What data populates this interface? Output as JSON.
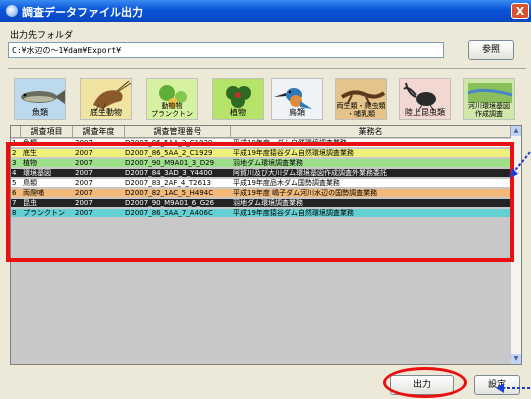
{
  "window": {
    "title": "調査データファイル出力",
    "close_glyph": "X"
  },
  "output_folder": {
    "label": "出力先フォルダ",
    "value": "C:¥水辺の〜1¥dam¥Export¥",
    "browse_label": "参照"
  },
  "categories": [
    {
      "label": "魚類",
      "icon": "fish-icon"
    },
    {
      "label": "底生動物",
      "icon": "shrimp-icon"
    },
    {
      "label": "動植物\nプランクトン",
      "icon": "plankton-icon"
    },
    {
      "label": "植物",
      "icon": "plant-icon"
    },
    {
      "label": "鳥類",
      "icon": "kingfisher-icon"
    },
    {
      "label": "両生類・爬虫類\n・哺乳類",
      "icon": "salamander-icon"
    },
    {
      "label": "陸上昆虫類",
      "icon": "beetle-icon"
    },
    {
      "label": "河川環境基図\n作成調査",
      "icon": "map-photo-icon"
    }
  ],
  "table": {
    "columns": [
      "",
      "調査項目",
      "調査年度",
      "調査管理番号",
      "業務名"
    ],
    "rows": [
      {
        "num": "1",
        "item": "魚類",
        "year": "2007",
        "code": "D2007_86_5AA_2_C1929",
        "name": "平成19年度…ダム自然環境調査業務",
        "bg": "#ffffff",
        "fg": "#000000"
      },
      {
        "num": "2",
        "item": "底生",
        "year": "2007",
        "code": "D2007_86_5AA_2_C1929",
        "name": "平成19年度猿谷ダム自然環境調査業務",
        "bg": "#f0f07a",
        "fg": "#000000"
      },
      {
        "num": "3",
        "item": "植物",
        "year": "2007",
        "code": "D2007_90_M9A01_3_D29",
        "name": "羽地ダム環境調査業務",
        "bg": "#9ce08a",
        "fg": "#000000"
      },
      {
        "num": "4",
        "item": "環境基図",
        "year": "2007",
        "code": "D2007_84_3AD_3_Y4400",
        "name": "阿賀川及び大川ダム環境基図作成調査外業務委託",
        "bg": "#232323",
        "fg": "#ffffff"
      },
      {
        "num": "5",
        "item": "鳥類",
        "year": "2007",
        "code": "D2007_83_2AF_4_T2613",
        "name": "平成19年度品木ダム国勢調査業務",
        "bg": "#ffffff",
        "fg": "#000000"
      },
      {
        "num": "6",
        "item": "両爬哺",
        "year": "2007",
        "code": "D2007_82_1AC_5_H494C",
        "name": "平成19年度 嶋子ダム河川水辺の国勢調査業務",
        "bg": "#f2b978",
        "fg": "#000000"
      },
      {
        "num": "7",
        "item": "昆虫",
        "year": "2007",
        "code": "D2007_90_M9A01_6_G26",
        "name": "羽地ダム環境調査業務",
        "bg": "#232323",
        "fg": "#ffffff"
      },
      {
        "num": "8",
        "item": "プランクトン",
        "year": "2007",
        "code": "D2007_86_5AA_7_A406C",
        "name": "平成19年度猿谷ダム自然環境調査業務",
        "bg": "#63d0d4",
        "fg": "#000000"
      }
    ]
  },
  "buttons": {
    "output_label": "出力",
    "settings_label": "設定"
  },
  "colors": {
    "highlight": "#e81010",
    "arrow": "#1a3fd6"
  }
}
